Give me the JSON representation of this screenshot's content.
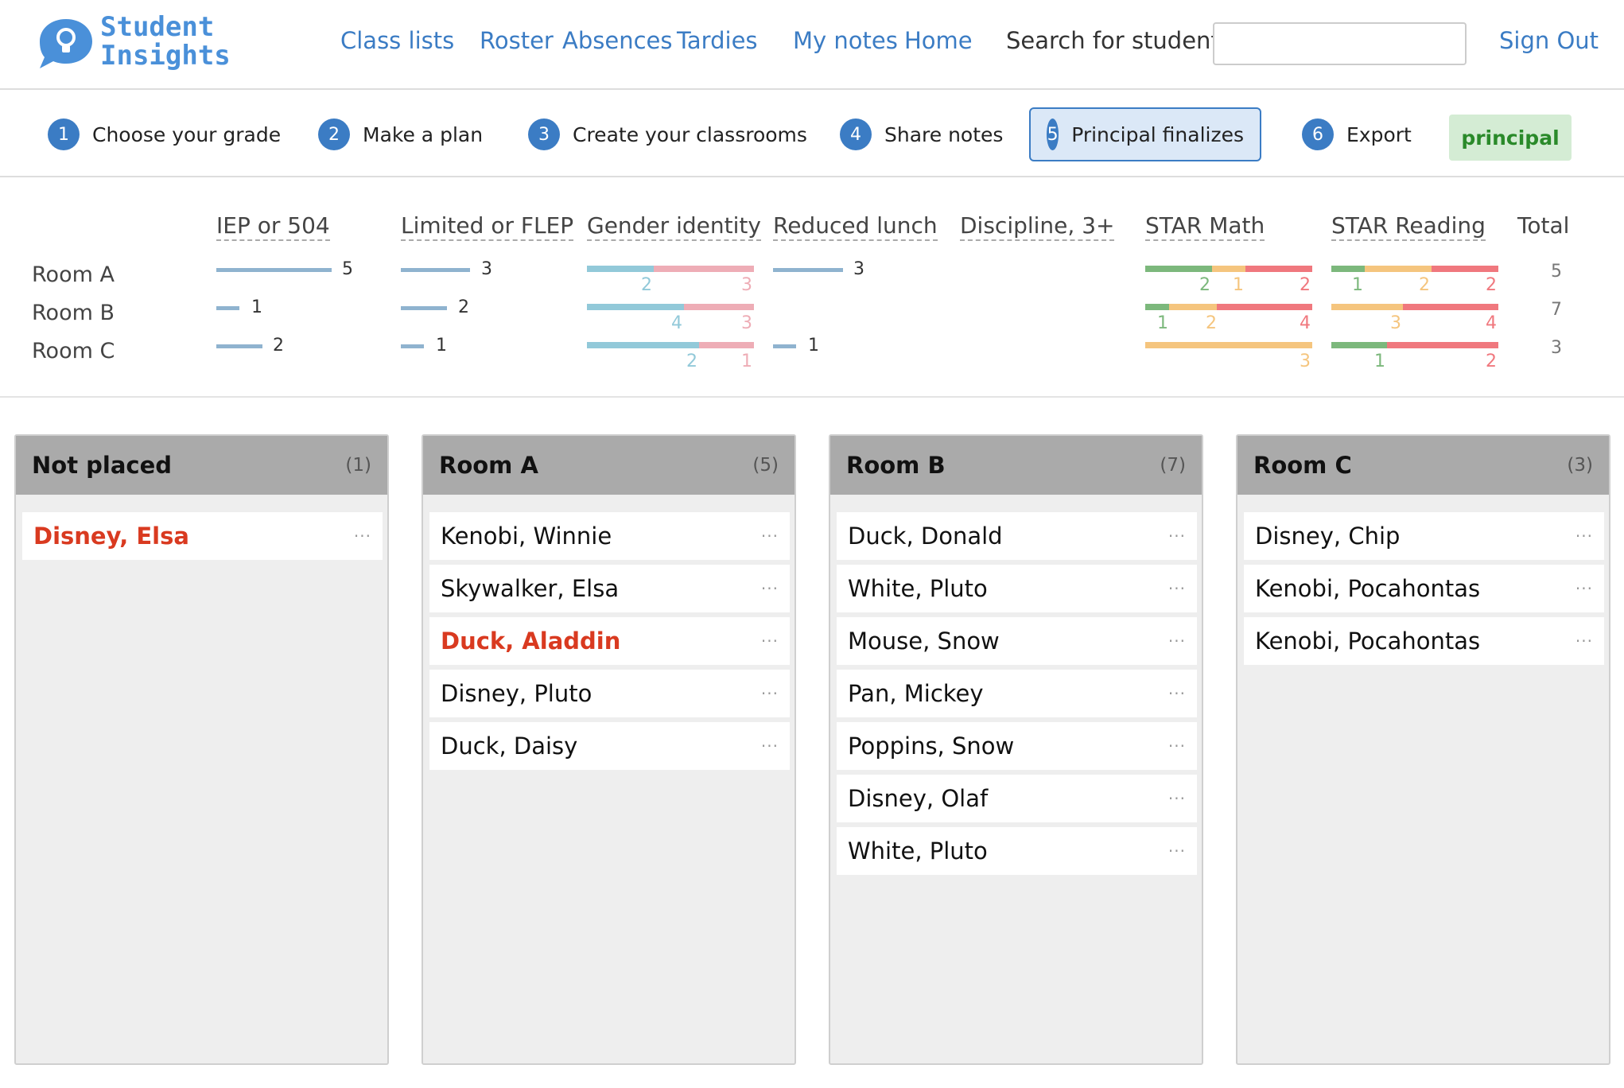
{
  "brand": {
    "line1": "Student",
    "line2": "Insights",
    "icon": "lightbulb-icon"
  },
  "nav": {
    "links": [
      "Class lists",
      "Roster",
      "Absences",
      "Tardies",
      "My notes",
      "Home"
    ],
    "search_label": "Search for student:",
    "search_value": "",
    "sign_out": "Sign Out"
  },
  "steps": [
    {
      "num": "1",
      "label": "Choose your grade"
    },
    {
      "num": "2",
      "label": "Make a plan"
    },
    {
      "num": "3",
      "label": "Create your classrooms"
    },
    {
      "num": "4",
      "label": "Share notes"
    },
    {
      "num": "5",
      "label": "Principal finalizes",
      "active": true
    },
    {
      "num": "6",
      "label": "Export"
    }
  ],
  "role_badge": "principal",
  "colors": {
    "accent": "#3b7cc4",
    "bar_blue": "#8fb3cf",
    "gender_a": "#92c9d9",
    "gender_b": "#eeadb6",
    "star_green": "#7cb87c",
    "star_orange": "#f5c57e",
    "star_red": "#f0787e",
    "alert": "#d93a20"
  },
  "summary": {
    "headers": [
      "IEP or 504",
      "Limited or FLEP",
      "Gender identity",
      "Reduced lunch",
      "Discipline, 3+",
      "STAR Math",
      "STAR Reading",
      "Total"
    ],
    "rows": [
      {
        "label": "Room A",
        "iep": "5",
        "flep": "3",
        "gender": [
          "2",
          "3"
        ],
        "lunch": "3",
        "star_math": [
          "2",
          "1",
          "2"
        ],
        "star_reading": [
          "1",
          "2",
          "2"
        ],
        "total": "5"
      },
      {
        "label": "Room B",
        "iep": "1",
        "flep": "2",
        "gender": [
          "4",
          "3"
        ],
        "lunch": "",
        "star_math": [
          "1",
          "2",
          "4"
        ],
        "star_reading": [
          "3",
          "4"
        ],
        "total": "7"
      },
      {
        "label": "Room C",
        "iep": "2",
        "flep": "1",
        "gender": [
          "2",
          "1"
        ],
        "lunch": "1",
        "star_math": [
          "3"
        ],
        "star_reading": [
          "1",
          "2"
        ],
        "total": "3"
      }
    ]
  },
  "board": [
    {
      "title": "Not placed",
      "count": "(1)",
      "students": [
        {
          "name": "Disney, Elsa",
          "alert": true
        }
      ]
    },
    {
      "title": "Room A",
      "count": "(5)",
      "students": [
        {
          "name": "Kenobi, Winnie"
        },
        {
          "name": "Skywalker, Elsa"
        },
        {
          "name": "Duck, Aladdin",
          "alert": true
        },
        {
          "name": "Disney, Pluto"
        },
        {
          "name": "Duck, Daisy"
        }
      ]
    },
    {
      "title": "Room B",
      "count": "(7)",
      "students": [
        {
          "name": "Duck, Donald"
        },
        {
          "name": "White, Pluto"
        },
        {
          "name": "Mouse, Snow"
        },
        {
          "name": "Pan, Mickey"
        },
        {
          "name": "Poppins, Snow"
        },
        {
          "name": "Disney, Olaf"
        },
        {
          "name": "White, Pluto"
        }
      ]
    },
    {
      "title": "Room C",
      "count": "(3)",
      "students": [
        {
          "name": "Disney, Chip"
        },
        {
          "name": "Kenobi, Pocahontas"
        },
        {
          "name": "Kenobi, Pocahontas"
        }
      ]
    }
  ],
  "card_menu": "···"
}
